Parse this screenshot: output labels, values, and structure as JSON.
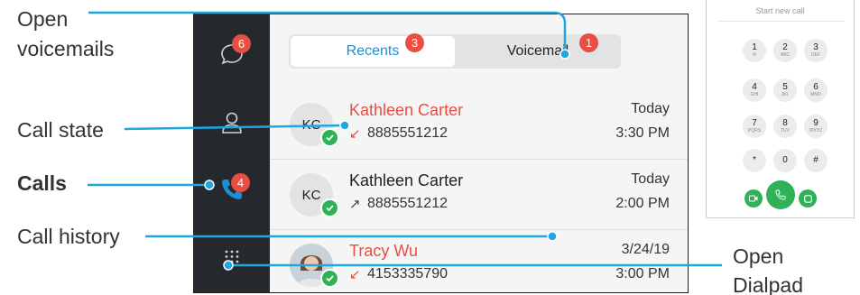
{
  "annotations": {
    "open_voicemails": [
      "Open",
      "voicemails"
    ],
    "call_state": "Call state",
    "calls": "Calls",
    "call_history": "Call history",
    "open_dialpad": [
      "Open",
      "Dialpad"
    ]
  },
  "sidebar": {
    "voicemail_badge": "6",
    "calls_badge": "4"
  },
  "tabs": {
    "recents_label": "Recents",
    "recents_badge": "3",
    "voicemail_label": "Voicemail",
    "voicemail_badge": "1"
  },
  "calls": [
    {
      "initials": "KC",
      "name": "Kathleen Carter",
      "number": "8885551212",
      "day": "Today",
      "time": "3:30 PM",
      "direction": "missed",
      "arrow": "↙"
    },
    {
      "initials": "KC",
      "name": "Kathleen Carter",
      "number": "8885551212",
      "day": "Today",
      "time": "2:00 PM",
      "direction": "outgoing",
      "arrow": "↗"
    },
    {
      "initials": "",
      "name": "Tracy Wu",
      "number": "4153335790",
      "day": "3/24/19",
      "time": "3:00 PM",
      "direction": "missed",
      "arrow": "↙"
    }
  ],
  "dialpad": {
    "title": "Start new call",
    "keys": [
      {
        "digit": "1",
        "letters": "✉"
      },
      {
        "digit": "2",
        "letters": "ABC"
      },
      {
        "digit": "3",
        "letters": "DEF"
      },
      {
        "digit": "4",
        "letters": "GHI"
      },
      {
        "digit": "5",
        "letters": "JKL"
      },
      {
        "digit": "6",
        "letters": "MNO"
      },
      {
        "digit": "7",
        "letters": "PQRS"
      },
      {
        "digit": "8",
        "letters": "TUV"
      },
      {
        "digit": "9",
        "letters": "WXYZ"
      },
      {
        "digit": "*",
        "letters": ""
      },
      {
        "digit": "0",
        "letters": ""
      },
      {
        "digit": "#",
        "letters": ""
      }
    ]
  },
  "colors": {
    "accent_blue": "#1a8fd6",
    "missed_red": "#e84e42",
    "call_green": "#2fb157",
    "sidebar_dark": "#25282c",
    "callout_line": "#1ea7e1"
  }
}
